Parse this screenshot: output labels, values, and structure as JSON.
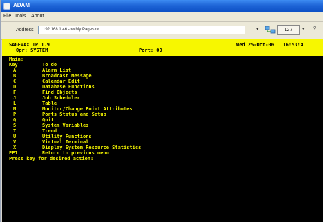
{
  "window": {
    "title": "ADAM"
  },
  "menu": {
    "items": [
      "File",
      "Tools",
      "About"
    ]
  },
  "address": {
    "label": "Address",
    "value": "192.168.1.46 - <<My Pages>>",
    "button_label": "127"
  },
  "status": {
    "line1_left": "SAGEVAX IP 1.9",
    "line1_right": "Wed 25-Oct-06   16:53:4",
    "line2_left": "Opr: SYSTEM",
    "line2_mid": "Port: 00"
  },
  "terminal": {
    "menu_title": "Main:",
    "header": {
      "key": "Key",
      "todo": "To do"
    },
    "items": [
      {
        "key": "A",
        "label": "Alarm List"
      },
      {
        "key": "B",
        "label": "Broadcast Message"
      },
      {
        "key": "C",
        "label": "Calendar Edit"
      },
      {
        "key": "D",
        "label": "Database Functions"
      },
      {
        "key": "F",
        "label": "Find Objects"
      },
      {
        "key": "J",
        "label": "Job Scheduler"
      },
      {
        "key": "L",
        "label": "Table"
      },
      {
        "key": "M",
        "label": "Monitor/Change Point Attributes"
      },
      {
        "key": "P",
        "label": "Ports Status and Setup"
      },
      {
        "key": "Q",
        "label": "Quit"
      },
      {
        "key": "S",
        "label": "System Variables"
      },
      {
        "key": "T",
        "label": "Trend"
      },
      {
        "key": "U",
        "label": "Utility Functions"
      },
      {
        "key": "V",
        "label": "Virtual Terminal"
      },
      {
        "key": "X",
        "label": "Display System Resource Statistics"
      },
      {
        "key": "PF1",
        "label": "Return to previous menu"
      }
    ],
    "prompt": "Press key for desired action:"
  }
}
